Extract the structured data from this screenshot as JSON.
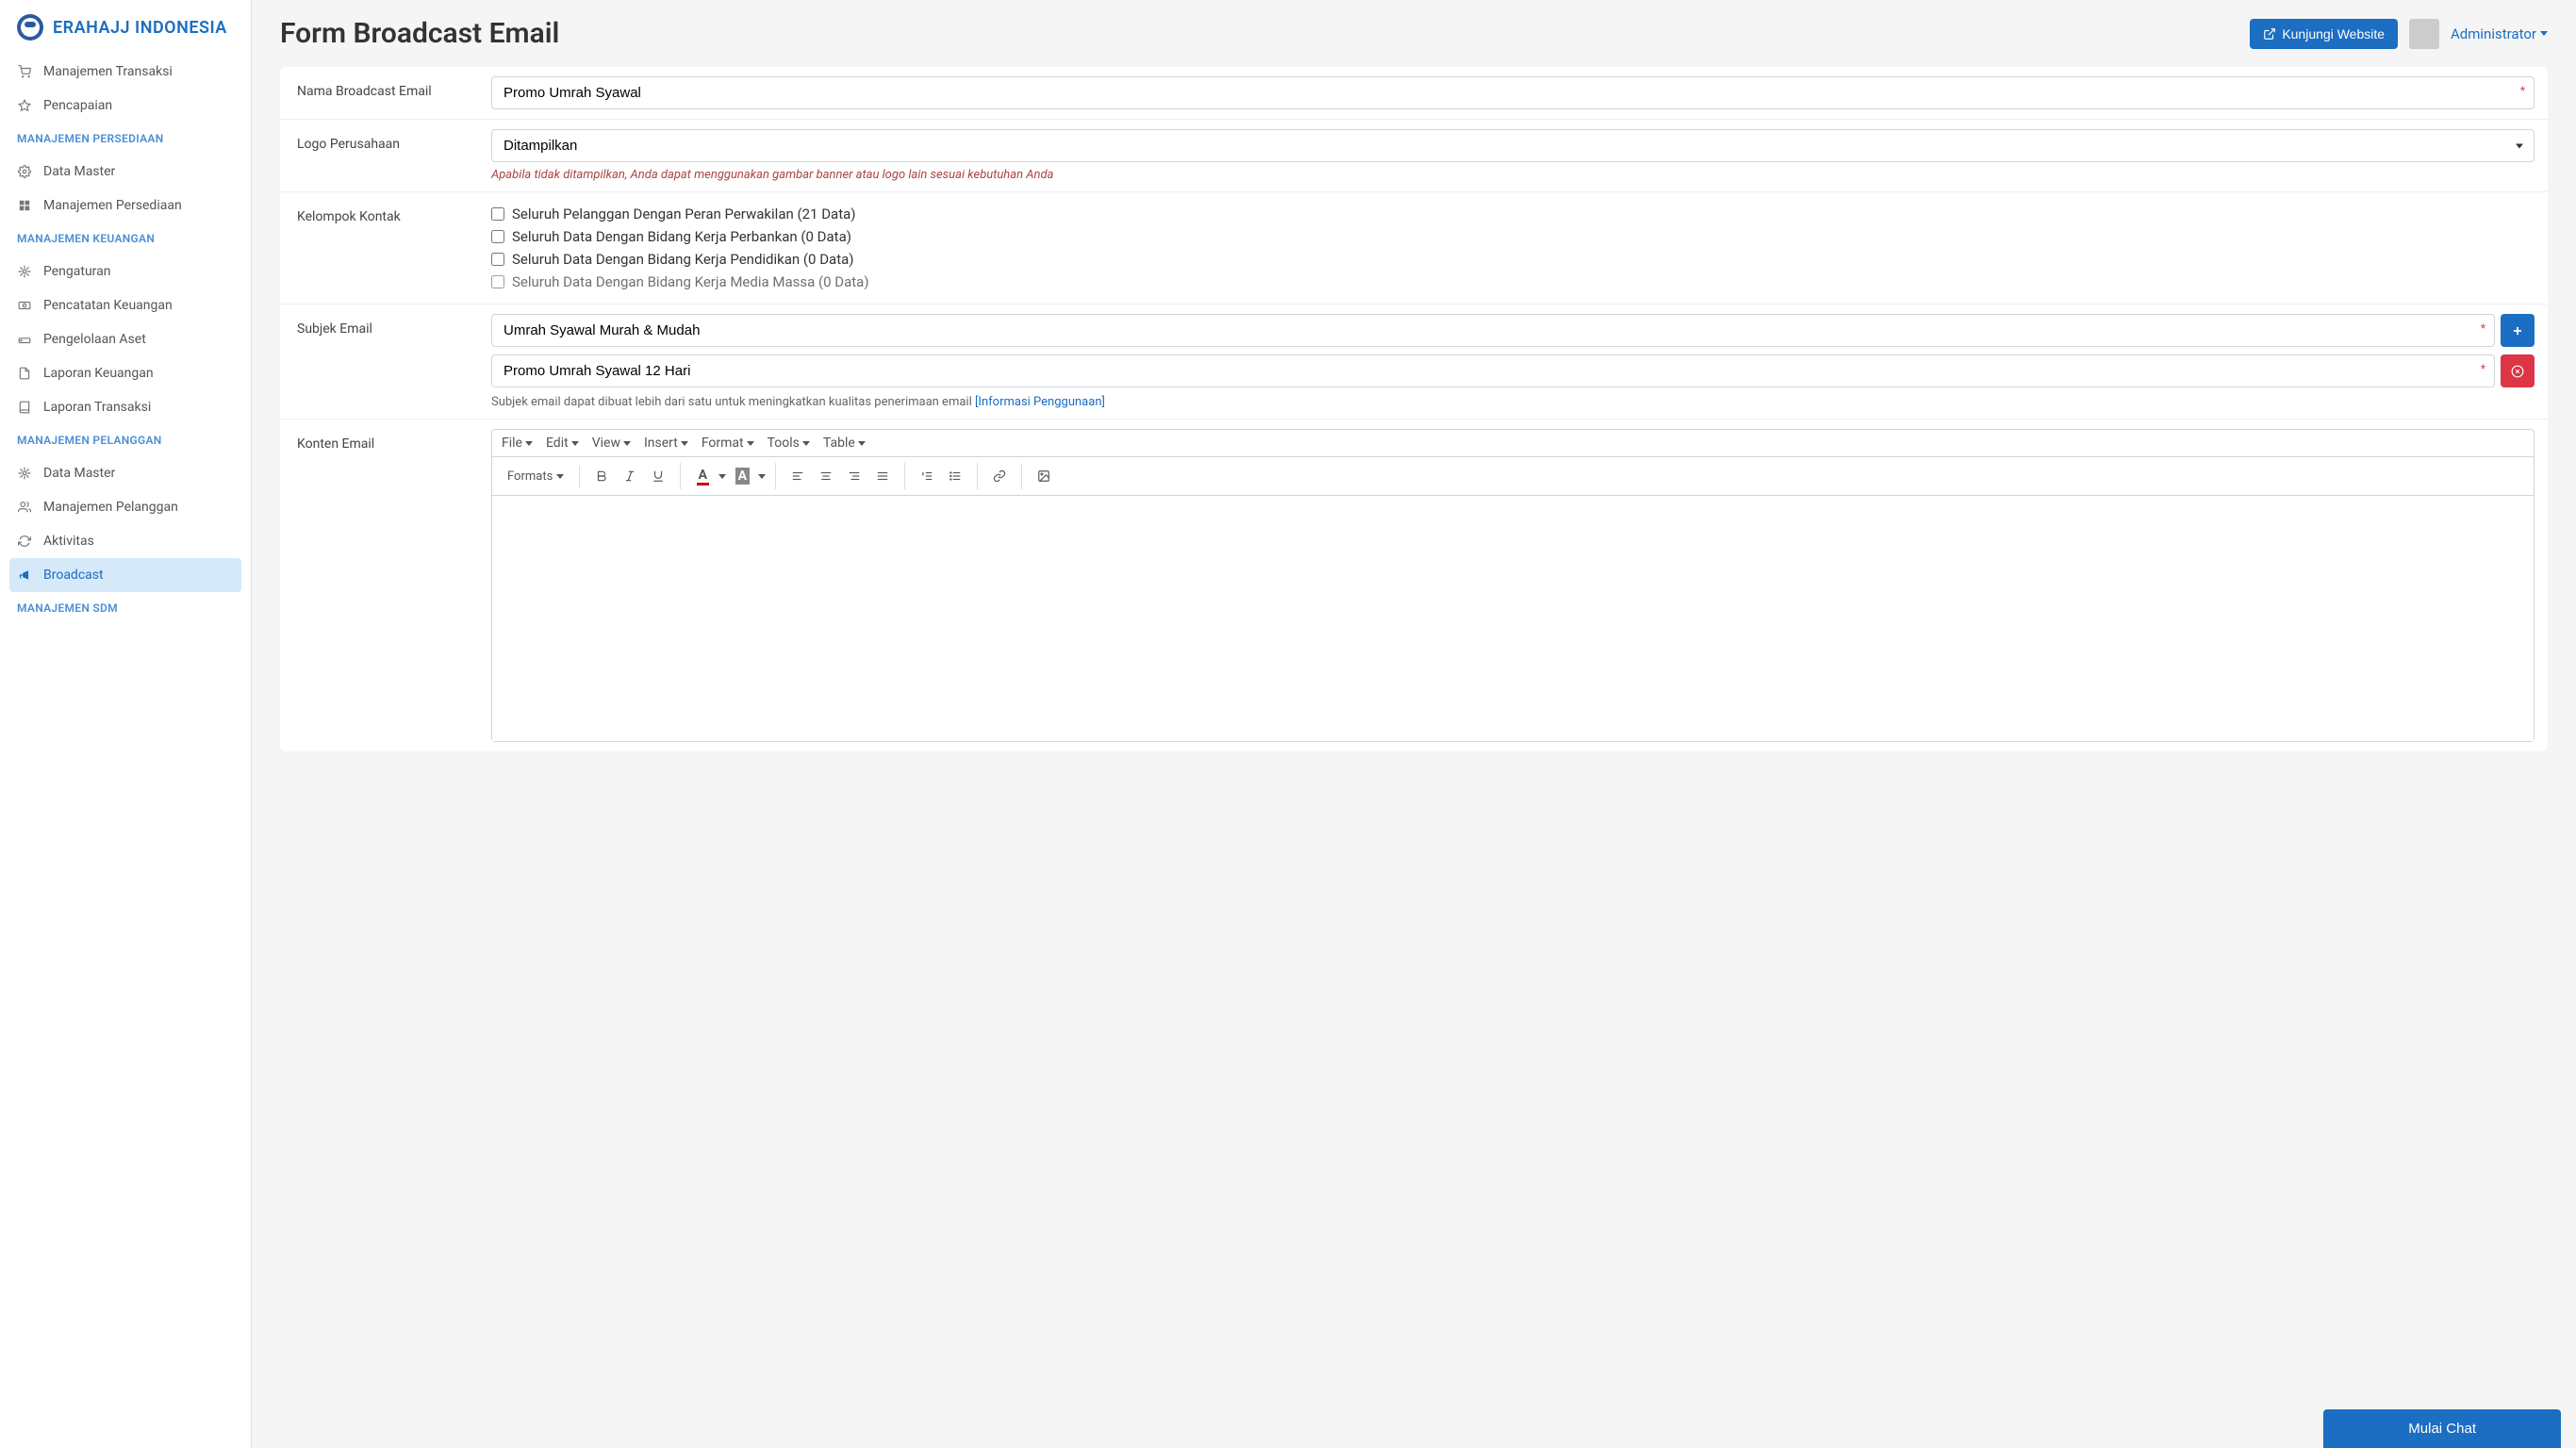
{
  "brand": "ERAHAJJ INDONESIA",
  "page_title": "Form Broadcast Email",
  "topbar": {
    "visit_button": "Kunjungi Website",
    "admin_label": "Administrator"
  },
  "sidebar": {
    "items_top": [
      {
        "label": "Manajemen Transaksi",
        "icon": "cart"
      },
      {
        "label": "Pencapaian",
        "icon": "star"
      }
    ],
    "sections": [
      {
        "title": "MANAJEMEN PERSEDIAAN",
        "items": [
          {
            "label": "Data Master",
            "icon": "cog"
          },
          {
            "label": "Manajemen Persediaan",
            "icon": "boxes"
          }
        ]
      },
      {
        "title": "MANAJEMEN KEUANGAN",
        "items": [
          {
            "label": "Pengaturan",
            "icon": "cog"
          },
          {
            "label": "Pencatatan Keuangan",
            "icon": "money"
          },
          {
            "label": "Pengelolaan Aset",
            "icon": "hdd"
          },
          {
            "label": "Laporan Keuangan",
            "icon": "report"
          },
          {
            "label": "Laporan Transaksi",
            "icon": "book"
          }
        ]
      },
      {
        "title": "MANAJEMEN PELANGGAN",
        "items": [
          {
            "label": "Data Master",
            "icon": "cog"
          },
          {
            "label": "Manajemen Pelanggan",
            "icon": "users"
          },
          {
            "label": "Aktivitas",
            "icon": "recycle"
          },
          {
            "label": "Broadcast",
            "icon": "bullhorn",
            "active": true
          }
        ]
      },
      {
        "title": "MANAJEMEN SDM",
        "items": []
      }
    ]
  },
  "form": {
    "nama_label": "Nama Broadcast Email",
    "nama_value": "Promo Umrah Syawal",
    "logo_label": "Logo Perusahaan",
    "logo_value": "Ditampilkan",
    "logo_hint": "Apabila tidak ditampilkan, Anda dapat menggunakan gambar banner atau logo lain sesuai kebutuhan Anda",
    "kelompok_label": "Kelompok Kontak",
    "kelompok_options": [
      "Seluruh Pelanggan Dengan Peran Perwakilan (21 Data)",
      "Seluruh Data Dengan Bidang Kerja Perbankan (0 Data)",
      "Seluruh Data Dengan Bidang Kerja Pendidikan (0 Data)",
      "Seluruh Data Dengan Bidang Kerja Media Massa (0 Data)"
    ],
    "subjek_label": "Subjek Email",
    "subjek_values": [
      "Umrah Syawal Murah & Mudah",
      "Promo Umrah Syawal 12 Hari"
    ],
    "subjek_hint": "Subjek email dapat dibuat lebih dari satu untuk meningkatkan kualitas penerimaan email ",
    "subjek_hint_link": "[Informasi Penggunaan]",
    "konten_label": "Konten Email"
  },
  "editor": {
    "menus": [
      "File",
      "Edit",
      "View",
      "Insert",
      "Format",
      "Tools",
      "Table"
    ],
    "formats_label": "Formats"
  },
  "chat_button": "Mulai Chat"
}
